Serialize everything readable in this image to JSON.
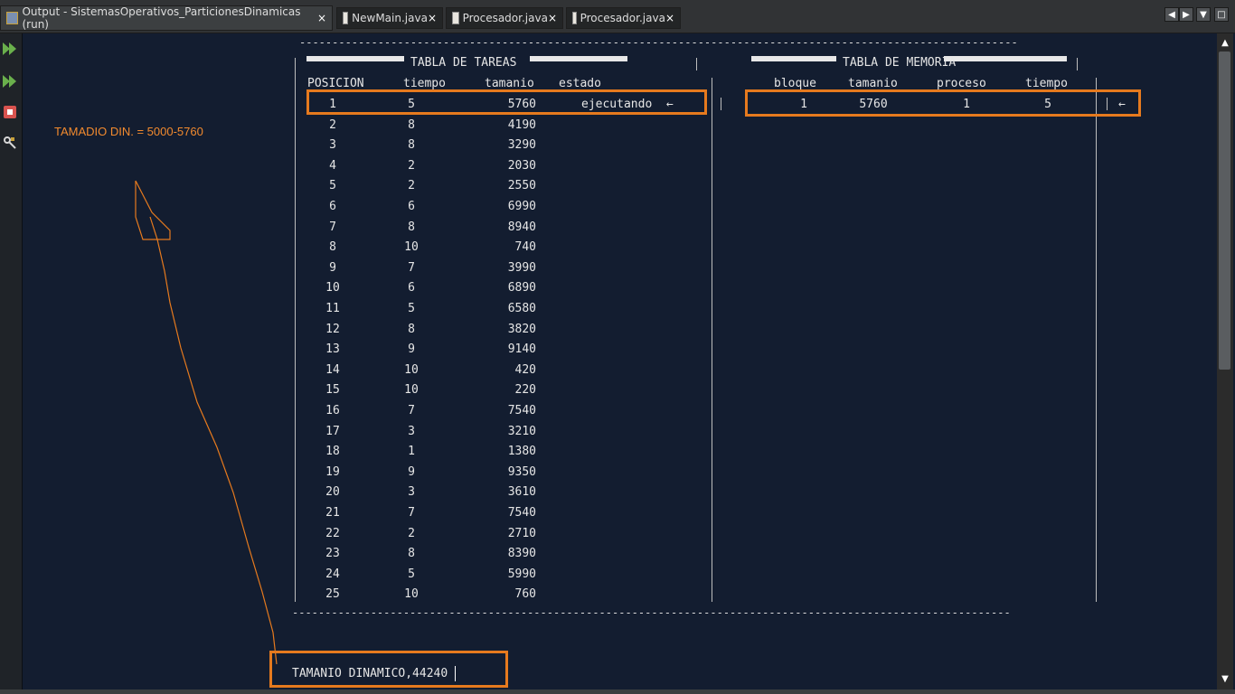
{
  "tabs": [
    {
      "label": "Output - SistemasOperativos_ParticionesDinamicas (run)",
      "active": true
    },
    {
      "label": "NewMain.java",
      "active": false
    },
    {
      "label": "Procesador.java",
      "active": false
    },
    {
      "label": "Procesador.java",
      "active": false
    }
  ],
  "tab_close_glyph": "×",
  "window_controls": [
    "◀",
    "▶",
    "▼",
    "□"
  ],
  "console": {
    "separator": "--------------------------------------------------------------------------------------------------------------",
    "tareas_title": "TABLA DE TAREAS",
    "memoria_title": "TABLA DE MEMORIA",
    "tareas_columns": [
      "POSICION",
      "tiempo",
      "tamanio",
      "estado"
    ],
    "memoria_columns": [
      "bloque",
      "tamanio",
      "proceso",
      "tiempo"
    ],
    "tareas_rows": [
      {
        "pos": "1",
        "tiempo": "5",
        "tamanio": "5760",
        "estado": "ejecutando  ←"
      },
      {
        "pos": "2",
        "tiempo": "8",
        "tamanio": "4190",
        "estado": ""
      },
      {
        "pos": "3",
        "tiempo": "8",
        "tamanio": "3290",
        "estado": ""
      },
      {
        "pos": "4",
        "tiempo": "2",
        "tamanio": "2030",
        "estado": ""
      },
      {
        "pos": "5",
        "tiempo": "2",
        "tamanio": "2550",
        "estado": ""
      },
      {
        "pos": "6",
        "tiempo": "6",
        "tamanio": "6990",
        "estado": ""
      },
      {
        "pos": "7",
        "tiempo": "8",
        "tamanio": "8940",
        "estado": ""
      },
      {
        "pos": "8",
        "tiempo": "10",
        "tamanio": "740",
        "estado": ""
      },
      {
        "pos": "9",
        "tiempo": "7",
        "tamanio": "3990",
        "estado": ""
      },
      {
        "pos": "10",
        "tiempo": "6",
        "tamanio": "6890",
        "estado": ""
      },
      {
        "pos": "11",
        "tiempo": "5",
        "tamanio": "6580",
        "estado": ""
      },
      {
        "pos": "12",
        "tiempo": "8",
        "tamanio": "3820",
        "estado": ""
      },
      {
        "pos": "13",
        "tiempo": "9",
        "tamanio": "9140",
        "estado": ""
      },
      {
        "pos": "14",
        "tiempo": "10",
        "tamanio": "420",
        "estado": ""
      },
      {
        "pos": "15",
        "tiempo": "10",
        "tamanio": "220",
        "estado": ""
      },
      {
        "pos": "16",
        "tiempo": "7",
        "tamanio": "7540",
        "estado": ""
      },
      {
        "pos": "17",
        "tiempo": "3",
        "tamanio": "3210",
        "estado": ""
      },
      {
        "pos": "18",
        "tiempo": "1",
        "tamanio": "1380",
        "estado": ""
      },
      {
        "pos": "19",
        "tiempo": "9",
        "tamanio": "9350",
        "estado": ""
      },
      {
        "pos": "20",
        "tiempo": "3",
        "tamanio": "3610",
        "estado": ""
      },
      {
        "pos": "21",
        "tiempo": "7",
        "tamanio": "7540",
        "estado": ""
      },
      {
        "pos": "22",
        "tiempo": "2",
        "tamanio": "2710",
        "estado": ""
      },
      {
        "pos": "23",
        "tiempo": "8",
        "tamanio": "8390",
        "estado": ""
      },
      {
        "pos": "24",
        "tiempo": "5",
        "tamanio": "5990",
        "estado": ""
      },
      {
        "pos": "25",
        "tiempo": "10",
        "tamanio": "760",
        "estado": ""
      }
    ],
    "memoria_rows": [
      {
        "bloque": "1",
        "tamanio": "5760",
        "proceso": "1",
        "tiempo": "5",
        "marker": "←"
      }
    ],
    "final_line": "TAMANIO DINAMICO,44240"
  },
  "annotation": "TAMADIO DIN. = 5000-5760",
  "colors": {
    "console_bg": "#131d30",
    "highlight": "#e67a1e",
    "annotation": "#f28a2e",
    "text": "#e6e6e6"
  },
  "icons": [
    "output-icon",
    "java-file-icon",
    "rerun-icon",
    "rerun-different-icon",
    "stop-icon",
    "settings-icon"
  ]
}
